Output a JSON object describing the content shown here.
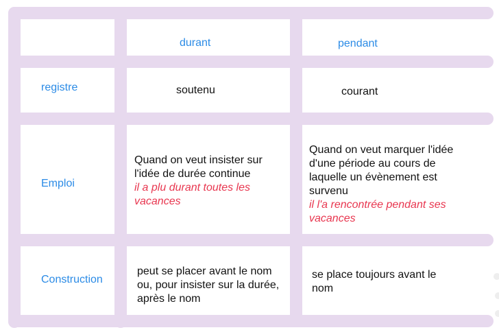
{
  "table": {
    "headers": {
      "col1": "durant",
      "col2": "pendant"
    },
    "rows": [
      {
        "label": "registre",
        "col1": [
          "soutenu"
        ],
        "col1_example": [],
        "col2": [
          "courant"
        ],
        "col2_example": []
      },
      {
        "label": "Emploi",
        "col1": [
          "Quand on veut insister sur",
          "l'idée de durée continue"
        ],
        "col1_example": [
          "il a plu durant toutes les",
          "vacances"
        ],
        "col2": [
          "Quand on veut marquer l'idée",
          "d'une période au cours de",
          "laquelle un évènement est",
          "survenu"
        ],
        "col2_example": [
          "il l'a rencontrée pendant ses",
          "vacances"
        ]
      },
      {
        "label": "Construction",
        "col1": [
          "peut se placer avant le nom",
          "ou, pour insister sur la durée,",
          "après le nom"
        ],
        "col1_example": [],
        "col2": [
          "se place toujours avant le",
          "nom"
        ],
        "col2_example": []
      }
    ]
  },
  "colors": {
    "grid": "#e7d9ee",
    "header_text": "#2b8be6",
    "example_text": "#e8364f",
    "body_text": "#111111"
  }
}
